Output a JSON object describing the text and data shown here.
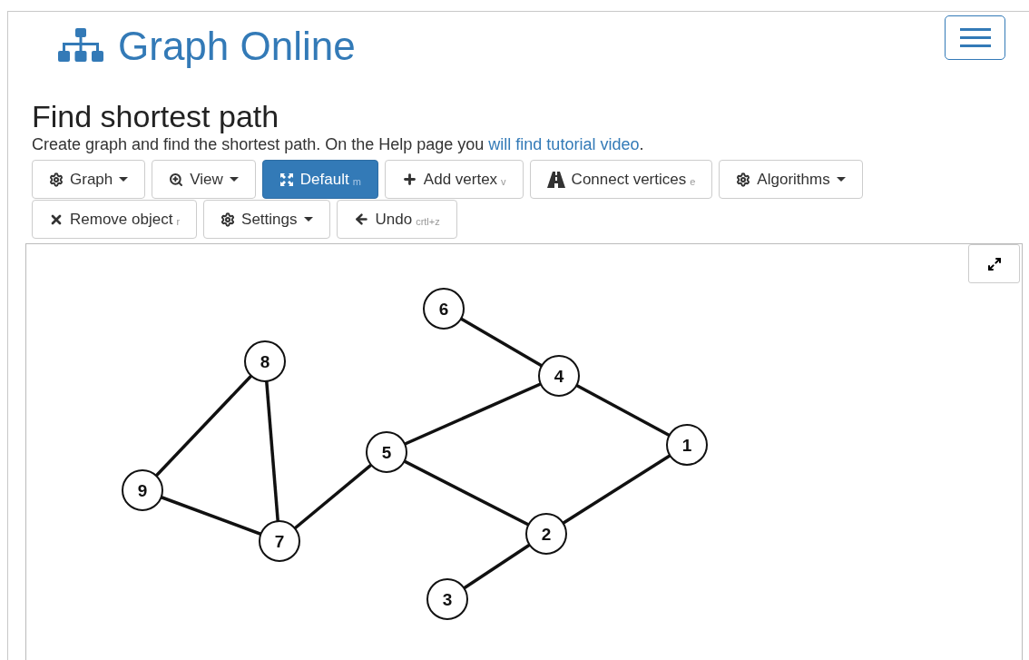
{
  "brand": {
    "title": "Graph Online"
  },
  "heading": "Find shortest path",
  "intro": {
    "text": "Create graph and find the shortest path. On the Help page you ",
    "link": "will find tutorial video",
    "end": "."
  },
  "toolbar": [
    {
      "label": "Graph",
      "dropdown": true,
      "selected": false
    },
    {
      "label": "View",
      "dropdown": true,
      "selected": false
    },
    {
      "label": "Default",
      "shortcut": "m",
      "dropdown": false,
      "selected": true
    },
    {
      "label": "Add vertex",
      "shortcut": "v",
      "dropdown": false,
      "selected": false
    },
    {
      "label": "Connect vertices",
      "shortcut": "e",
      "dropdown": false,
      "selected": false
    },
    {
      "label": "Algorithms",
      "dropdown": true,
      "selected": false
    },
    {
      "label": "Remove object",
      "shortcut": "r",
      "dropdown": false,
      "selected": false
    },
    {
      "label": "Settings",
      "dropdown": true,
      "selected": false
    },
    {
      "label": "Undo",
      "shortcut": "crtl+z",
      "dropdown": false,
      "selected": false
    }
  ],
  "graph": {
    "vertices": [
      "6",
      "8",
      "4",
      "5",
      "1",
      "9",
      "7",
      "2",
      "3"
    ]
  }
}
